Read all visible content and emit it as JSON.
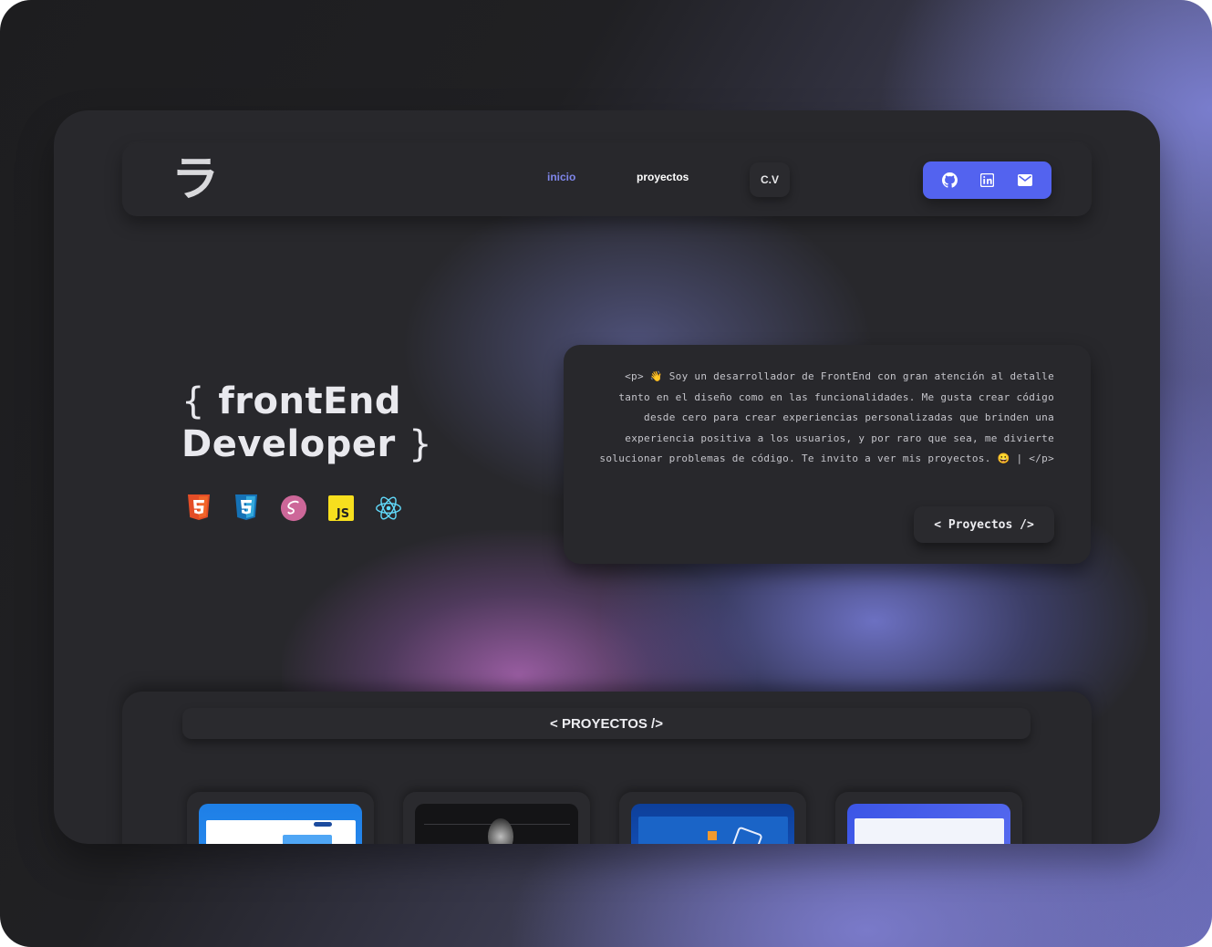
{
  "nav": {
    "logo": "ラ",
    "links": [
      {
        "label": "inicio",
        "active": true
      },
      {
        "label": "proyectos",
        "active": false
      }
    ],
    "cv_label": "C.V",
    "social_icons": [
      "github-icon",
      "linkedin-icon",
      "mail-icon"
    ],
    "accent_color": "#5363ef",
    "active_color": "#7f86ea"
  },
  "hero": {
    "title_open": "{",
    "title_line1": "frontEnd",
    "title_line2": "Developer",
    "title_close": "}",
    "tech_icons": [
      "html5-icon",
      "css3-icon",
      "sass-icon",
      "javascript-icon",
      "react-icon"
    ]
  },
  "about": {
    "text": "<p> 👋 Soy un desarrollador de FrontEnd con gran atención al detalle tanto en el diseño como en las funcionalidades. Me gusta crear código desde cero para crear experiencias personalizadas que brinden una experiencia positiva a los usuarios, y por raro que sea, me divierte solucionar problemas de código. Te invito a ver mis proyectos. 😀 | </p>",
    "button_label": "< Proyectos />"
  },
  "projects": {
    "header": "< PROYECTOS />"
  }
}
